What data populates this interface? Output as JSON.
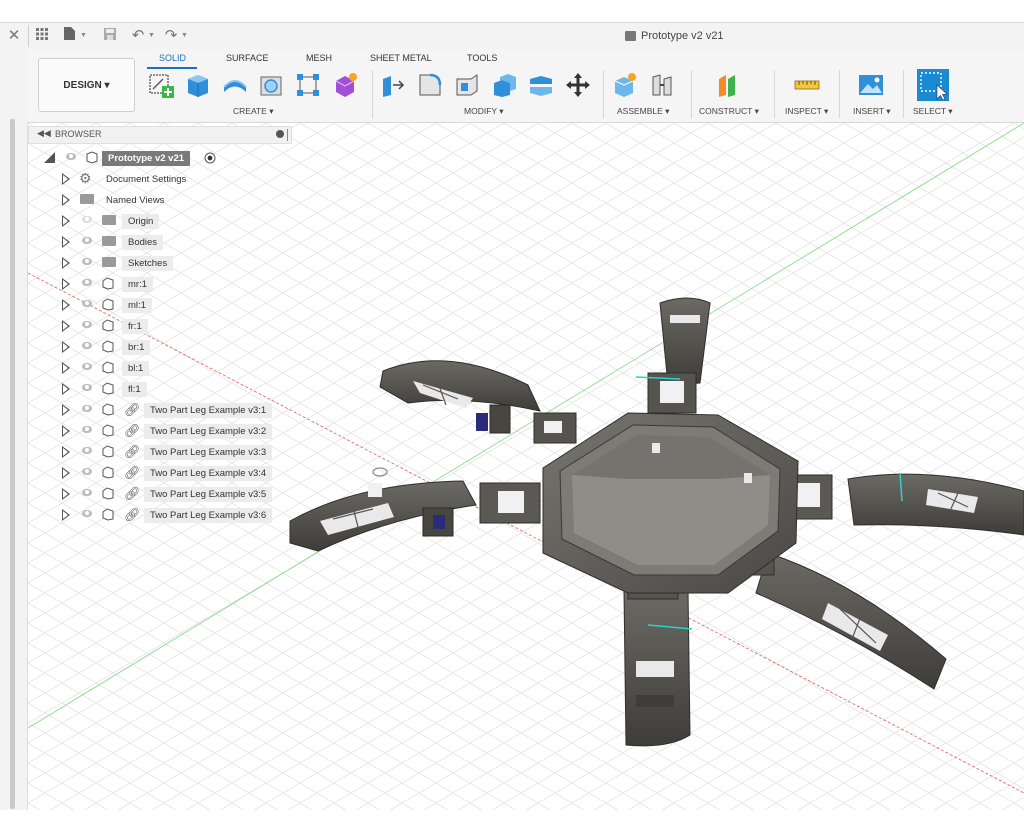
{
  "title_bar": {
    "document_title": "Prototype  v2 v21",
    "icons": [
      "close-icon",
      "grid-menu-icon",
      "file-icon",
      "save-icon",
      "undo-icon",
      "redo-icon"
    ]
  },
  "toolbar": {
    "workspace_label": "DESIGN ▾",
    "tabs": [
      {
        "label": "SOLID",
        "active": true
      },
      {
        "label": "SURFACE",
        "active": false
      },
      {
        "label": "MESH",
        "active": false
      },
      {
        "label": "SHEET METAL",
        "active": false
      },
      {
        "label": "TOOLS",
        "active": false
      }
    ],
    "groups": [
      {
        "label": "CREATE ▾"
      },
      {
        "label": "MODIFY ▾"
      },
      {
        "label": "ASSEMBLE ▾"
      },
      {
        "label": "CONSTRUCT ▾"
      },
      {
        "label": "INSPECT ▾"
      },
      {
        "label": "INSERT ▾"
      },
      {
        "label": "SELECT ▾"
      }
    ],
    "accent_color": "#1a6fc4"
  },
  "browser": {
    "header": "BROWSER",
    "root": "Prototype  v2 v21",
    "items": [
      {
        "label": "Document Settings",
        "icon": "gear-icon"
      },
      {
        "label": "Named Views",
        "icon": "folder-icon"
      },
      {
        "label": "Origin",
        "icon": "folder-icon",
        "hidden": true
      },
      {
        "label": "Bodies",
        "icon": "folder-icon"
      },
      {
        "label": "Sketches",
        "icon": "folder-icon"
      },
      {
        "label": "mr:1",
        "icon": "component-icon"
      },
      {
        "label": "ml:1",
        "icon": "component-icon"
      },
      {
        "label": "fr:1",
        "icon": "component-icon"
      },
      {
        "label": "br:1",
        "icon": "component-icon"
      },
      {
        "label": "bl:1",
        "icon": "component-icon"
      },
      {
        "label": "fl:1",
        "icon": "component-icon"
      },
      {
        "label": "Two Part Leg Example v3:1",
        "icon": "link-icon"
      },
      {
        "label": "Two Part Leg Example v3:2",
        "icon": "link-icon"
      },
      {
        "label": "Two Part Leg Example v3:3",
        "icon": "link-icon"
      },
      {
        "label": "Two Part Leg Example v3:4",
        "icon": "link-icon"
      },
      {
        "label": "Two Part Leg Example v3:5",
        "icon": "link-icon"
      },
      {
        "label": "Two Part Leg Example v3:6",
        "icon": "link-icon"
      }
    ]
  },
  "viewport": {
    "model": "hexapod-prototype",
    "x_axis_color": "#e85a5a",
    "y_axis_color": "#7fd97f",
    "model_color": "#5e5d58"
  }
}
